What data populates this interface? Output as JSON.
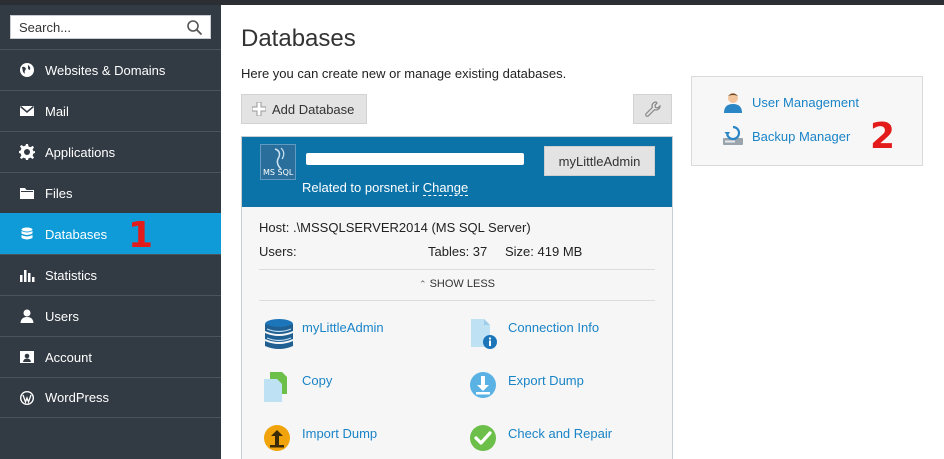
{
  "sidebar": {
    "search_placeholder": "Search...",
    "items": [
      {
        "label": "Websites & Domains",
        "icon": "globe-icon"
      },
      {
        "label": "Mail",
        "icon": "mail-icon"
      },
      {
        "label": "Applications",
        "icon": "gear-icon"
      },
      {
        "label": "Files",
        "icon": "folder-icon"
      },
      {
        "label": "Databases",
        "icon": "database-icon",
        "active": true
      },
      {
        "label": "Statistics",
        "icon": "bar-chart-icon"
      },
      {
        "label": "Users",
        "icon": "user-icon"
      },
      {
        "label": "Account",
        "icon": "account-icon"
      },
      {
        "label": "WordPress",
        "icon": "wordpress-icon"
      }
    ],
    "annotation_marker": "1"
  },
  "main": {
    "title": "Databases",
    "description": "Here you can create new or manage existing databases.",
    "add_button_label": "Add Database",
    "database": {
      "icon_label": "MS SQL",
      "related_prefix": "Related to porsnet.ir",
      "change_link": "Change",
      "admin_button": "myLittleAdmin",
      "host": "Host: .\\MSSQLSERVER2014 (MS SQL Server)",
      "users_label": "Users:",
      "tables": "Tables: 37",
      "size": "Size: 419 MB",
      "show_less": "SHOW LESS",
      "actions": [
        {
          "label": "myLittleAdmin",
          "icon": "database-stack-icon"
        },
        {
          "label": "Connection Info",
          "icon": "connection-info-icon"
        },
        {
          "label": "Copy",
          "icon": "copy-icon"
        },
        {
          "label": "Export Dump",
          "icon": "export-dump-icon"
        },
        {
          "label": "Import Dump",
          "icon": "import-dump-icon"
        },
        {
          "label": "Check and Repair",
          "icon": "check-repair-icon"
        }
      ]
    }
  },
  "side_panel": {
    "user_management": "User Management",
    "backup_manager": "Backup Manager",
    "annotation_marker": "2"
  },
  "colors": {
    "sidebar_bg": "#323a43",
    "active_item": "#0f9bd7",
    "db_header": "#0c73a8",
    "link": "#1a84c7",
    "marker": "#e31b1b"
  }
}
